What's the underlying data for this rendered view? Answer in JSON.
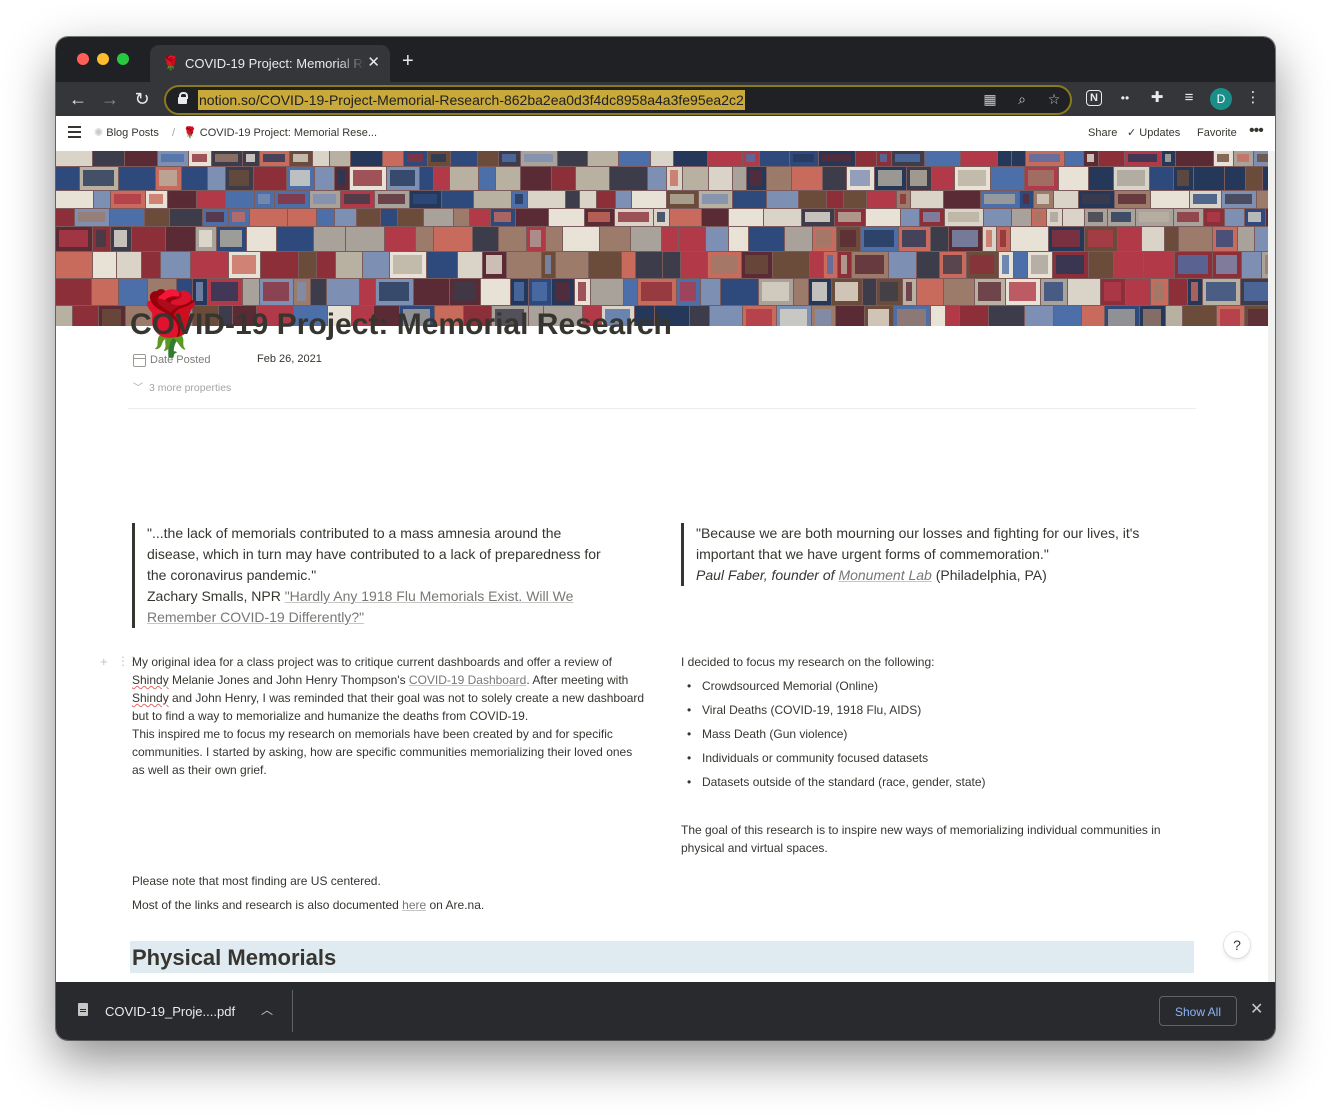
{
  "browser": {
    "tab_title": "COVID-19 Project: Memorial Re",
    "tab_emoji": "🌹",
    "url": "notion.so/COVID-19-Project-Memorial-Research-862ba2ea0d3f4dc8958a4a3fe95ea2c2",
    "avatar_letter": "D"
  },
  "notion_topbar": {
    "breadcrumb_1": "Blog Posts",
    "breadcrumb_sep": "/",
    "breadcrumb_2": "COVID-19 Project: Memorial Rese...",
    "share": "Share",
    "updates": "Updates",
    "favorite": "Favorite"
  },
  "page": {
    "icon": "🌹",
    "title": "COVID-19 Project: Memorial Research",
    "property_name": "Date Posted",
    "property_value": "Feb 26, 2021",
    "more_properties": "3 more properties"
  },
  "quote_left": {
    "text": "\"...the lack of memorials contributed to a mass amnesia around the disease, which in turn may have contributed to a lack of preparedness for the coronavirus pandemic.\"",
    "attribution": "Zachary Smalls, NPR ",
    "link": "\"Hardly Any 1918 Flu Memorials Exist. Will We Remember COVID-19 Differently?\""
  },
  "quote_right": {
    "text": "\"Because we are both mourning our losses and fighting for our lives, it's important that we have urgent forms of commemoration.\"",
    "attribution": "Paul Faber, founder of ",
    "link": "Monument Lab",
    "location": " (Philadelphia, PA)"
  },
  "left_column": {
    "p1_a": "My original idea for a class project was to critique current dashboards and offer a review of ",
    "p1_shindy": "Shindy",
    "p1_b": " Melanie Jones and John Henry Thompson's ",
    "p1_link": "COVID-19 Dashboard",
    "p1_c": ".  After meeting with ",
    "p1_shindy2": "Shindy",
    "p1_d": " and John Henry, I was reminded that their goal was not to solely create a new dashboard but to find a way to memorialize and humanize the deaths from COVID-19.",
    "p2": "This inspired me to focus my research on memorials have been created by and for specific communities.  I started by asking, how are specific communities memorializing their loved ones as well as their own grief."
  },
  "right_column": {
    "intro": "I decided to focus my research on the following:",
    "items": [
      "Crowdsourced Memorial (Online)",
      "Viral Deaths (COVID-19, 1918 Flu, AIDS)",
      "Mass Death (Gun violence)",
      "Individuals or community focused datasets",
      "Datasets outside of the standard (race, gender, state)"
    ],
    "goal": "The goal of this research is to inspire new ways of memorializing individual communities in physical and virtual spaces."
  },
  "notes": {
    "note1": "Please note that most finding are US centered.",
    "note2_a": "Most of the links and research is also documented ",
    "note2_link": "here",
    "note2_b": " on Are.na."
  },
  "section_heading": "Physical Memorials",
  "help_label": "?",
  "download_bar": {
    "file_name": "COVID-19_Proje....pdf",
    "show_all": "Show All"
  },
  "icons": [
    "close-icon",
    "plus-icon",
    "back-arrow-icon",
    "forward-arrow-icon",
    "reload-icon",
    "lock-icon",
    "qr-code-icon",
    "zoom-icon",
    "star-icon",
    "notion-extension-icon",
    "link-extension-icon",
    "puzzle-extension-icon",
    "reading-list-icon",
    "kebab-menu-icon",
    "hamburger-icon",
    "calendar-icon",
    "check-icon",
    "file-icon",
    "chevron-up-icon"
  ]
}
